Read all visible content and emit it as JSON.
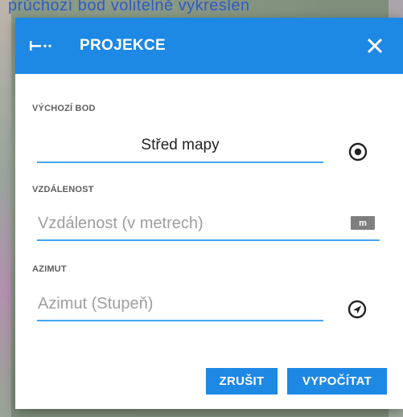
{
  "background": {
    "top_text": "průchozí bod volitelně vykreslen"
  },
  "dialog": {
    "title": "PROJEKCE",
    "header_icon": "projection-icon",
    "close_icon": "close-icon",
    "start_point": {
      "label": "VÝCHOZÍ BOD",
      "value": "Střed mapy",
      "icon": "target-icon"
    },
    "distance": {
      "label": "VZDÁLENOST",
      "placeholder": "Vzdálenost (v metrech)",
      "unit": "m"
    },
    "azimuth": {
      "label": "AZIMUT",
      "placeholder": "Azimut (Stupeň)",
      "icon": "navigation-icon"
    },
    "buttons": {
      "cancel": "ZRUŠIT",
      "calculate": "VYPOČÍTAT"
    }
  },
  "colors": {
    "accent": "#1e88e5",
    "underline": "#42a5f5"
  }
}
